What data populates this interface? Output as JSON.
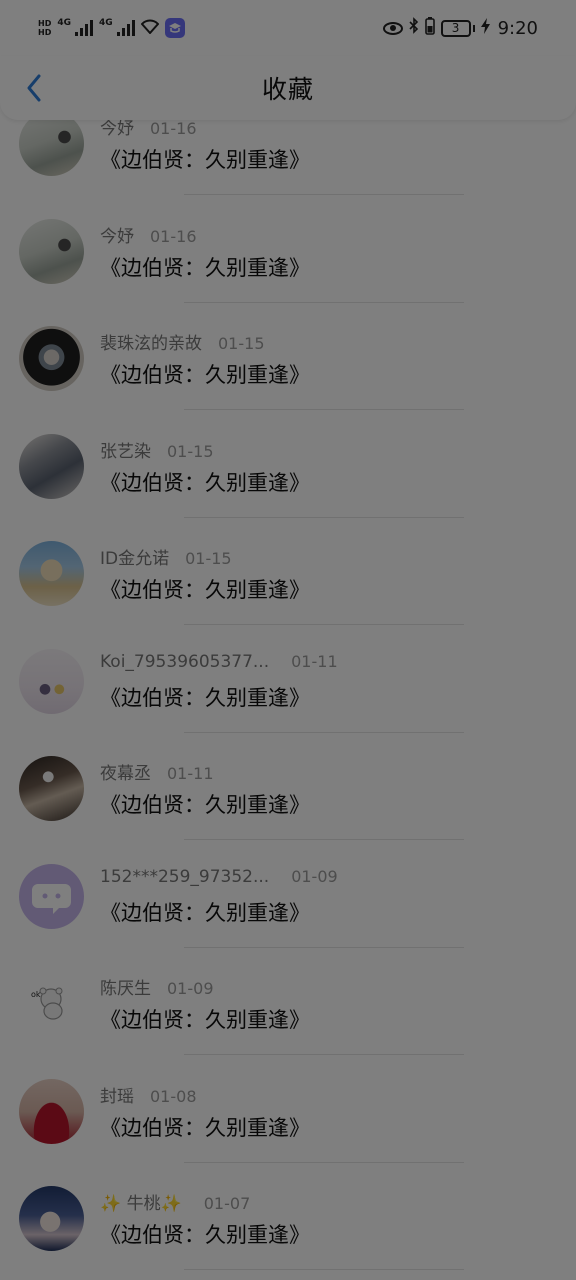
{
  "status_bar": {
    "hd_top": "HD",
    "hd_bottom": "HD",
    "network_1": "4G",
    "network_2": "4G",
    "battery_level": "3",
    "time": "9:20",
    "icons": [
      "signal-icon",
      "wifi-icon",
      "app-icon",
      "eye-icon",
      "bluetooth-icon",
      "battery-icon",
      "charging-icon"
    ]
  },
  "nav": {
    "title": "收藏",
    "back_icon": "chevron-left-icon",
    "accent_color": "#2f7cd6"
  },
  "list": {
    "items": [
      {
        "user": "今妤",
        "date": "01-16",
        "title": "《边伯贤：久别重逢》"
      },
      {
        "user": "今妤",
        "date": "01-16",
        "title": "《边伯贤：久别重逢》"
      },
      {
        "user": "裴珠泫的亲故",
        "date": "01-15",
        "title": "《边伯贤：久别重逢》"
      },
      {
        "user": "张艺染",
        "date": "01-15",
        "title": "《边伯贤：久别重逢》"
      },
      {
        "user": "ID金允诺",
        "date": "01-15",
        "title": "《边伯贤：久别重逢》"
      },
      {
        "user": "Koi_79539605377...",
        "date": "01-11",
        "title": "《边伯贤：久别重逢》"
      },
      {
        "user": "夜幕丞",
        "date": "01-11",
        "title": "《边伯贤：久别重逢》"
      },
      {
        "user": "152***259_97352...",
        "date": "01-09",
        "title": "《边伯贤：久别重逢》"
      },
      {
        "user": "陈厌生",
        "date": "01-09",
        "title": "《边伯贤：久别重逢》"
      },
      {
        "user": "封瑶",
        "date": "01-08",
        "title": "《边伯贤：久别重逢》"
      },
      {
        "user": "✨ 牛桃✨",
        "date": "01-07",
        "title": "《边伯贤：久别重逢》"
      }
    ],
    "bear_label": "ok"
  },
  "overlay": {
    "color": "rgba(0,0,0,0.5)"
  }
}
